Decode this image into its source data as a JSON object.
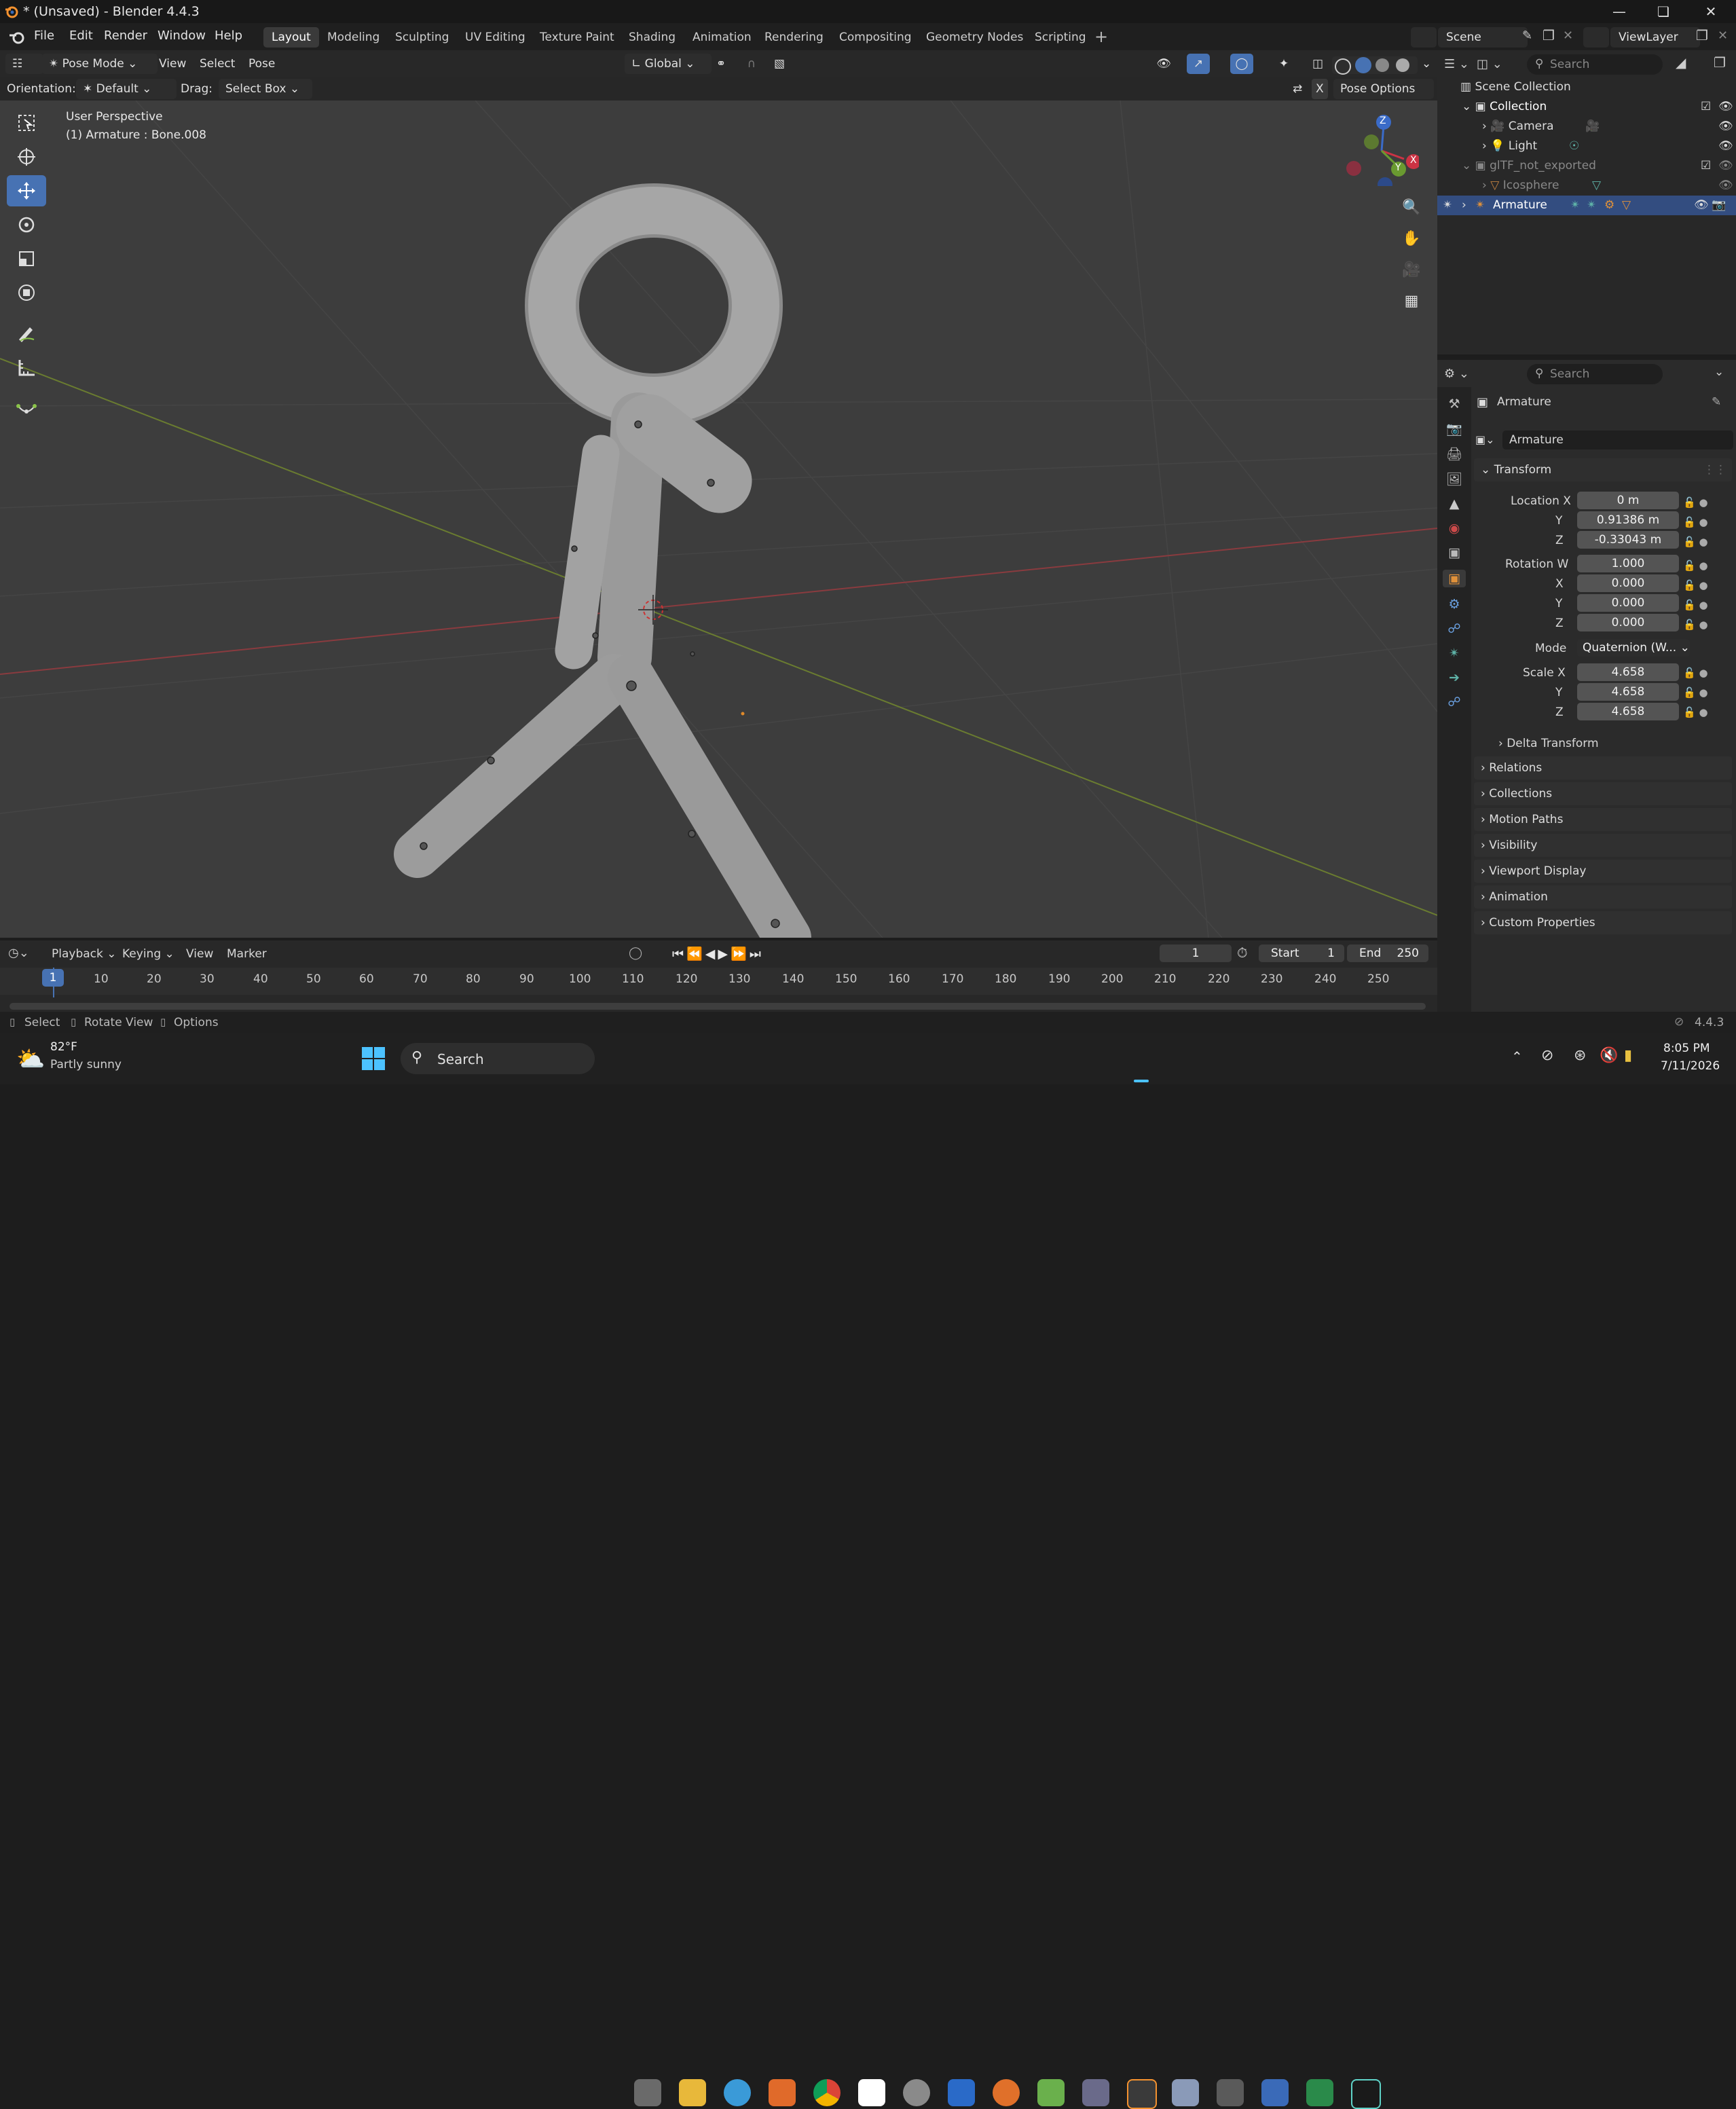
{
  "window": {
    "title": "* (Unsaved) - Blender 4.4.3"
  },
  "menu": [
    "File",
    "Edit",
    "Render",
    "Window",
    "Help"
  ],
  "workspaces": [
    "Layout",
    "Modeling",
    "Sculpting",
    "UV Editing",
    "Texture Paint",
    "Shading",
    "Animation",
    "Rendering",
    "Compositing",
    "Geometry Nodes",
    "Scripting"
  ],
  "active_workspace": "Layout",
  "scene": "Scene",
  "view_layer": "ViewLayer",
  "viewport_header": {
    "mode": "Pose Mode",
    "menus": [
      "View",
      "Select",
      "Pose"
    ],
    "transform_orientation": "Global",
    "orientation_label": "Orientation:",
    "orientation_value": "Default",
    "drag_label": "Drag:",
    "drag_value": "Select Box",
    "pose_options": "Pose Options",
    "x_label": "X"
  },
  "viewport": {
    "perspective": "User Perspective",
    "object_info": "(1) Armature : Bone.008",
    "gizmo": {
      "x": "X",
      "y": "Y",
      "z": "Z"
    }
  },
  "outliner": {
    "search_placeholder": "Search",
    "items": [
      {
        "label": "Scene Collection"
      },
      {
        "label": "Collection"
      },
      {
        "label": "Camera"
      },
      {
        "label": "Light"
      },
      {
        "label": "glTF_not_exported"
      },
      {
        "label": "Icosphere"
      },
      {
        "label": "Armature"
      }
    ]
  },
  "properties": {
    "search_placeholder": "Search",
    "object_name": "Armature",
    "datablock_name": "Armature",
    "transform_header": "Transform",
    "location_label": "Location X",
    "loc_x": "0 m",
    "loc_y": "0.91386 m",
    "loc_z": "-0.33043 m",
    "rotation_label": "Rotation W",
    "rot_w": "1.000",
    "rot_x": "0.000",
    "rot_y": "0.000",
    "rot_z": "0.000",
    "mode_label": "Mode",
    "mode_value": "Quaternion (W...",
    "scale_label": "Scale X",
    "scale_x": "4.658",
    "scale_y": "4.658",
    "scale_z": "4.658",
    "y_label": "Y",
    "z_label": "Z",
    "x_label": "X",
    "delta_transform": "Delta Transform",
    "panels": [
      "Relations",
      "Collections",
      "Motion Paths",
      "Visibility",
      "Viewport Display",
      "Animation",
      "Custom Properties"
    ]
  },
  "timeline": {
    "menus": [
      "Playback",
      "Keying",
      "View",
      "Marker"
    ],
    "current_frame": "1",
    "start_label": "Start",
    "start_value": "1",
    "end_label": "End",
    "end_value": "250",
    "ticks": [
      "10",
      "20",
      "30",
      "40",
      "50",
      "60",
      "70",
      "80",
      "90",
      "100",
      "110",
      "120",
      "130",
      "140",
      "150",
      "160",
      "170",
      "180",
      "190",
      "200",
      "210",
      "220",
      "230",
      "240",
      "250"
    ]
  },
  "status": {
    "select": "Select",
    "rotate": "Rotate View",
    "options": "Options",
    "version": "4.4.3"
  },
  "taskbar": {
    "weather_temp": "82°F",
    "weather_desc": "Partly sunny",
    "search": "Search",
    "time": "8:05 PM",
    "date": "7/11/2026"
  }
}
